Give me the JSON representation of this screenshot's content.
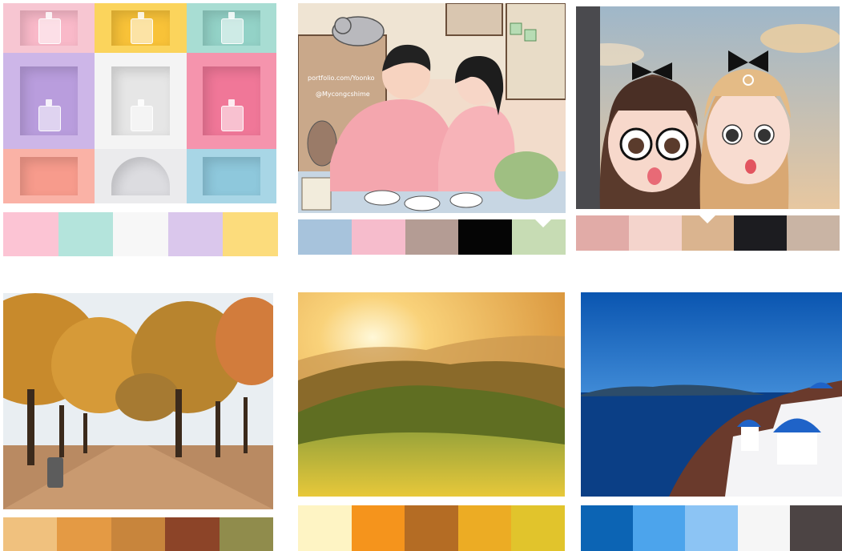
{
  "cards": [
    {
      "subject": "pastel perfume bottle grid",
      "palette": [
        "#fcc4d4",
        "#b4e4dc",
        "#f7f7f7",
        "#dac7ec",
        "#fcdc7c"
      ]
    },
    {
      "subject": "illustrated couple in pink sweaters",
      "watermark": [
        "portfolio.com/Yoonko",
        "@Mycongcshime"
      ],
      "palette": [
        "#a7c3dc",
        "#f6bccc",
        "#b49c94",
        "#050505",
        "#c7dcb4"
      ]
    },
    {
      "subject": "two 3D cartoon girls with black bows",
      "palette": [
        "#e1aba7",
        "#f4d4cc",
        "#dab48f",
        "#1c1c20",
        "#c9b4a4"
      ]
    },
    {
      "subject": "autumn tree-lined path",
      "palette": [
        "#f0c17e",
        "#e49a44",
        "#c8853c",
        "#8c4428",
        "#908c4c"
      ]
    },
    {
      "subject": "sunset over green hills",
      "palette": [
        "#fef4c4",
        "#f5941c",
        "#b46c24",
        "#ecac24",
        "#e1c42c"
      ]
    },
    {
      "subject": "Santorini blue domes and sea",
      "palette": [
        "#0c64b4",
        "#4ca4ec",
        "#8cc4f4",
        "#f6f6f6",
        "#4c4444"
      ]
    }
  ]
}
